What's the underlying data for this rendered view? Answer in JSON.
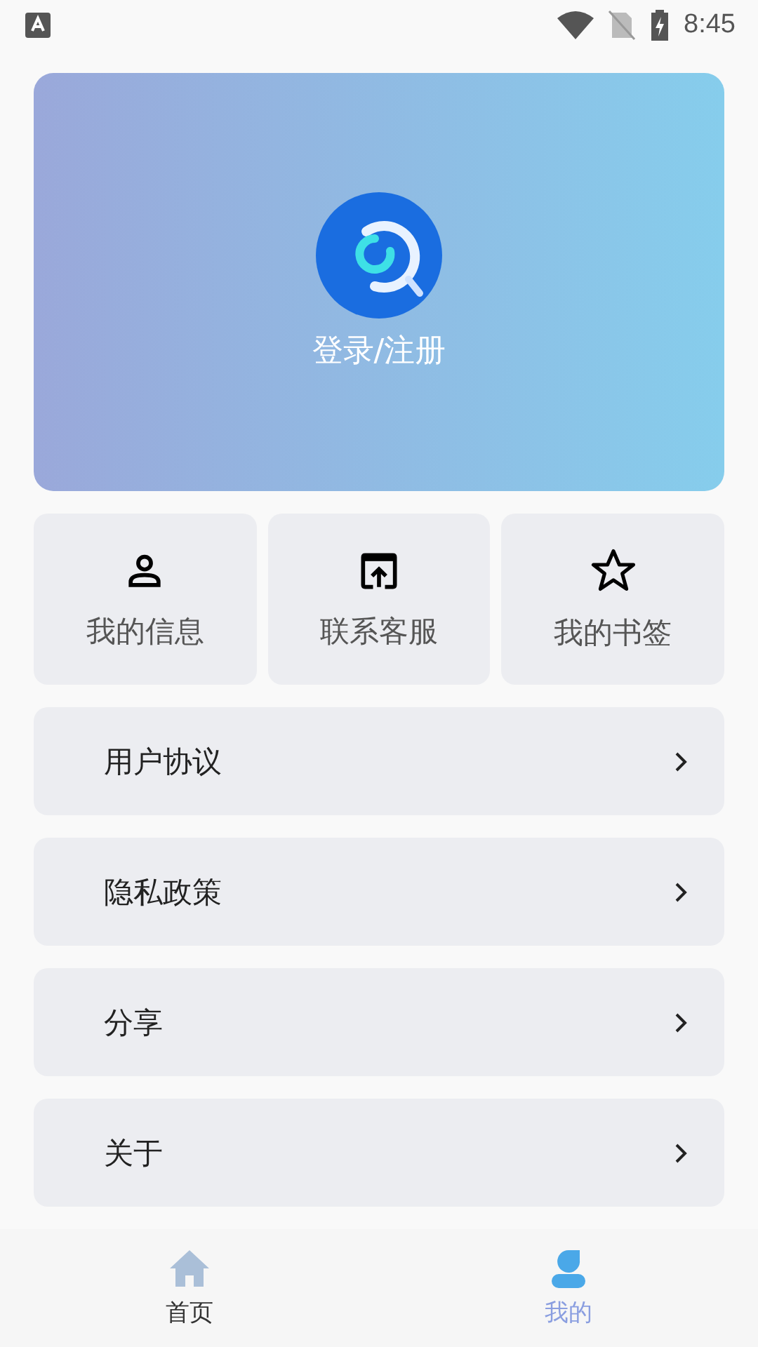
{
  "status_bar": {
    "time": "8:45"
  },
  "profile": {
    "login_label": "登录/注册"
  },
  "shortcuts": [
    {
      "label": "我的信息"
    },
    {
      "label": "联系客服"
    },
    {
      "label": "我的书签"
    }
  ],
  "menu": [
    {
      "label": "用户协议"
    },
    {
      "label": "隐私政策"
    },
    {
      "label": "分享"
    },
    {
      "label": "关于"
    }
  ],
  "bottom_nav": [
    {
      "label": "首页",
      "selected": false
    },
    {
      "label": "我的",
      "selected": true
    }
  ]
}
